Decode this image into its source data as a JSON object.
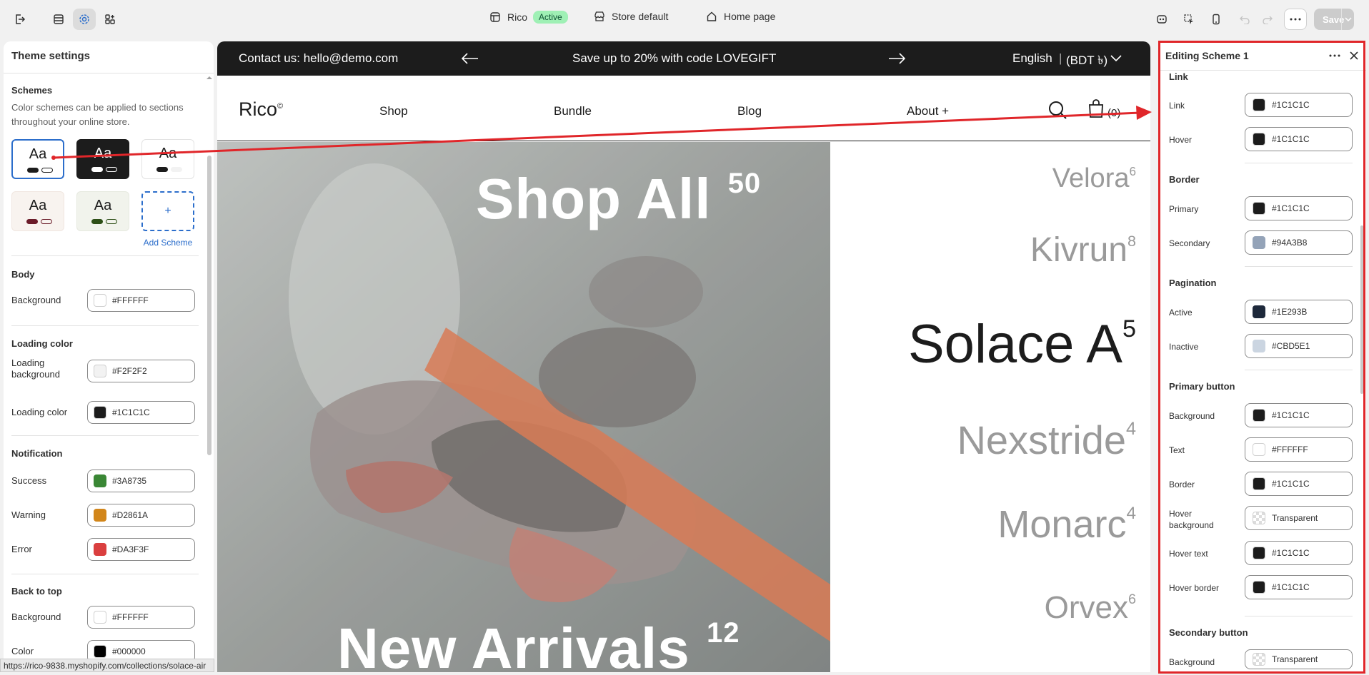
{
  "topbar": {
    "theme_name": "Rico",
    "theme_status": "Active",
    "store": "Store default",
    "page": "Home page",
    "save_label": "Save"
  },
  "left_panel": {
    "title": "Theme settings",
    "schemes_title": "Schemes",
    "schemes_desc": "Color schemes can be applied to sections throughout your online store.",
    "scheme_sample": "Aa",
    "add_scheme": "Add Scheme",
    "add_icon": "+",
    "body": {
      "title": "Body",
      "background_label": "Background",
      "background_value": "#FFFFFF"
    },
    "loading": {
      "title": "Loading color",
      "bg_label": "Loading background",
      "bg_value": "#F2F2F2",
      "color_label": "Loading color",
      "color_value": "#1C1C1C"
    },
    "notification": {
      "title": "Notification",
      "success_label": "Success",
      "success_value": "#3A8735",
      "warning_label": "Warning",
      "warning_value": "#D2861A",
      "error_label": "Error",
      "error_value": "#DA3F3F"
    },
    "back_to_top": {
      "title": "Back to top",
      "bg_label": "Background",
      "bg_value": "#FFFFFF",
      "color_label": "Color",
      "color_value": "#000000"
    },
    "status_url": "https://rico-9838.myshopify.com/collections/solace-air"
  },
  "preview": {
    "contact": "Contact us: hello@demo.com",
    "promo": "Save up to 20% with code LOVEGIFT",
    "locale": "English",
    "currency": "(BDT ৳)",
    "logo": "Rico",
    "logo_mark": "©",
    "nav": [
      "Shop",
      "Bundle",
      "Blog",
      "About +"
    ],
    "cart": "(0)",
    "hero_title": "Shop All",
    "hero_count": "50",
    "hero_title2": "New Arrivals",
    "hero_count2": "12",
    "products": [
      {
        "name": "Velora",
        "count": "6"
      },
      {
        "name": "Kivrun",
        "count": "8"
      },
      {
        "name": "Solace A",
        "count": "5"
      },
      {
        "name": "Nexstride",
        "count": "4"
      },
      {
        "name": "Monarc",
        "count": "4"
      },
      {
        "name": "Orvex",
        "count": "6"
      }
    ]
  },
  "right_panel": {
    "title": "Editing Scheme 1",
    "link": {
      "title": "Link",
      "link_label": "Link",
      "link_value": "#1C1C1C",
      "hover_label": "Hover",
      "hover_value": "#1C1C1C"
    },
    "border": {
      "title": "Border",
      "primary_label": "Primary",
      "primary_value": "#1C1C1C",
      "secondary_label": "Secondary",
      "secondary_value": "#94A3B8"
    },
    "pagination": {
      "title": "Pagination",
      "active_label": "Active",
      "active_value": "#1E293B",
      "inactive_label": "Inactive",
      "inactive_value": "#CBD5E1"
    },
    "primary_button": {
      "title": "Primary button",
      "bg_label": "Background",
      "bg_value": "#1C1C1C",
      "text_label": "Text",
      "text_value": "#FFFFFF",
      "border_label": "Border",
      "border_value": "#1C1C1C",
      "hover_bg_label": "Hover background",
      "hover_bg_value": "Transparent",
      "hover_text_label": "Hover text",
      "hover_text_value": "#1C1C1C",
      "hover_border_label": "Hover border",
      "hover_border_value": "#1C1C1C"
    },
    "secondary_button": {
      "title": "Secondary button",
      "bg_label": "Background",
      "bg_value": "Transparent"
    }
  },
  "colors": {
    "accent": "#2c6ecb",
    "highlight": "#e0262a",
    "badge_bg": "#9ff0b5"
  }
}
